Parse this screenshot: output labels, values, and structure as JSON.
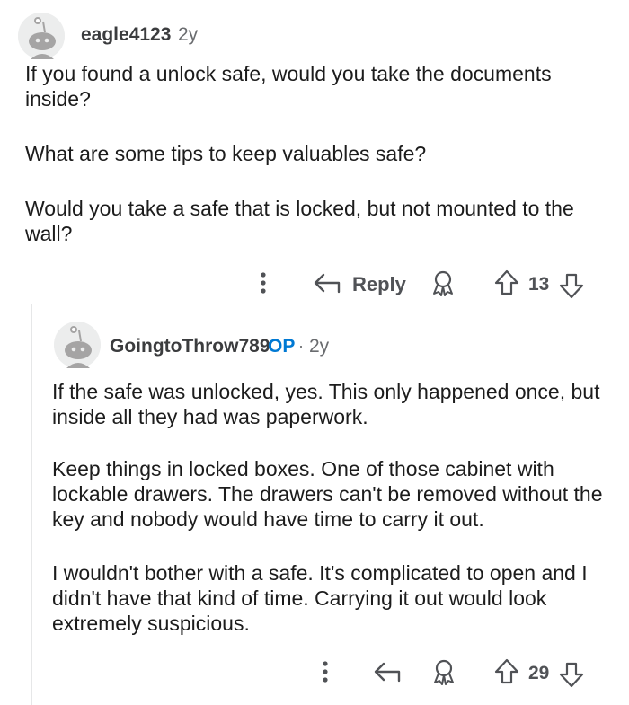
{
  "comment": {
    "username": "eagle4123",
    "age": "2y",
    "paragraphs": [
      "If you found a unlock safe, would you take the documents inside?",
      "What are some tips to keep valuables safe?",
      "Would you take a safe that is locked, but not mounted to the wall?"
    ],
    "actions": {
      "reply_label": "Reply",
      "vote_count": "13"
    }
  },
  "reply": {
    "username": "GoingtoThrow789",
    "op_badge": "OP",
    "separator": "·",
    "age": "2y",
    "paragraphs": [
      "If the safe was unlocked, yes. This only happened once, but inside all they had was paperwork.",
      "Keep things in locked boxes. One of those cabinet with lockable drawers. The drawers can't be removed without the key and nobody would have time to carry it out.",
      "I wouldn't bother with a safe. It's complicated to open and I didn't have that kind of time. Carrying it out would look extremely suspicious."
    ],
    "actions": {
      "vote_count": "29"
    }
  },
  "colors": {
    "text": "#1c1c1c",
    "meta": "#6a6c6f",
    "op": "#0079d3",
    "icon": "#505256"
  }
}
